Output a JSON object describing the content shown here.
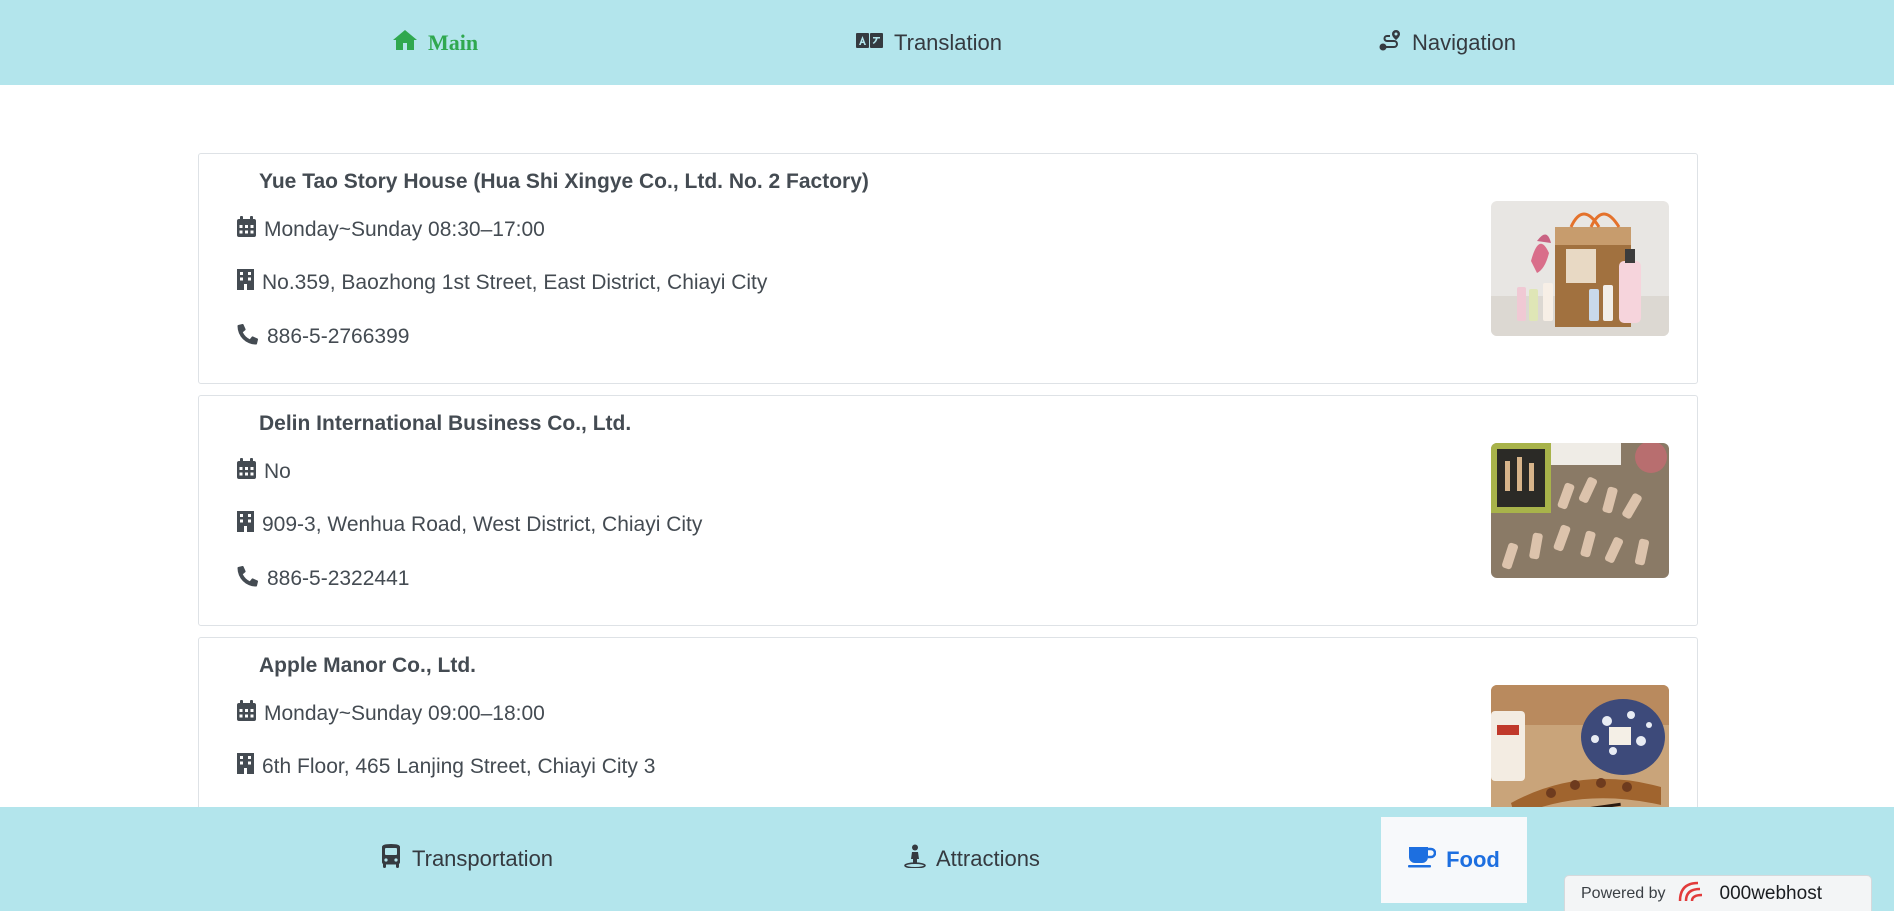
{
  "top_nav": {
    "main": "Main",
    "translation": "Translation",
    "navigation": "Navigation"
  },
  "items": [
    {
      "name": "Yue Tao Story House (Hua Shi Xingye Co., Ltd. No. 2 Factory)",
      "hours": "Monday~Sunday 08:30–17:00",
      "address": " No.359, Baozhong 1st Street, East District, Chiayi City",
      "phone": "886-5-2766399"
    },
    {
      "name": "Delin International Business Co., Ltd.",
      "hours": "No",
      "address": "909-3, Wenhua Road, West District, Chiayi City",
      "phone": "886-5-2322441"
    },
    {
      "name": "Apple Manor Co., Ltd.",
      "hours": "Monday~Sunday 09:00–18:00",
      "address": " 6th Floor, 465 Lanjing Street, Chiayi City 3",
      "phone": ""
    }
  ],
  "bottom_nav": {
    "transportation": "Transportation",
    "attractions": "Attractions",
    "food": "Food"
  },
  "powered_by": {
    "label": "Powered by",
    "brand": "000webhost"
  },
  "colors": {
    "nav_bg": "#b3e5ec",
    "main_active": "#2fa84f",
    "food_active": "#1d6fe0"
  }
}
